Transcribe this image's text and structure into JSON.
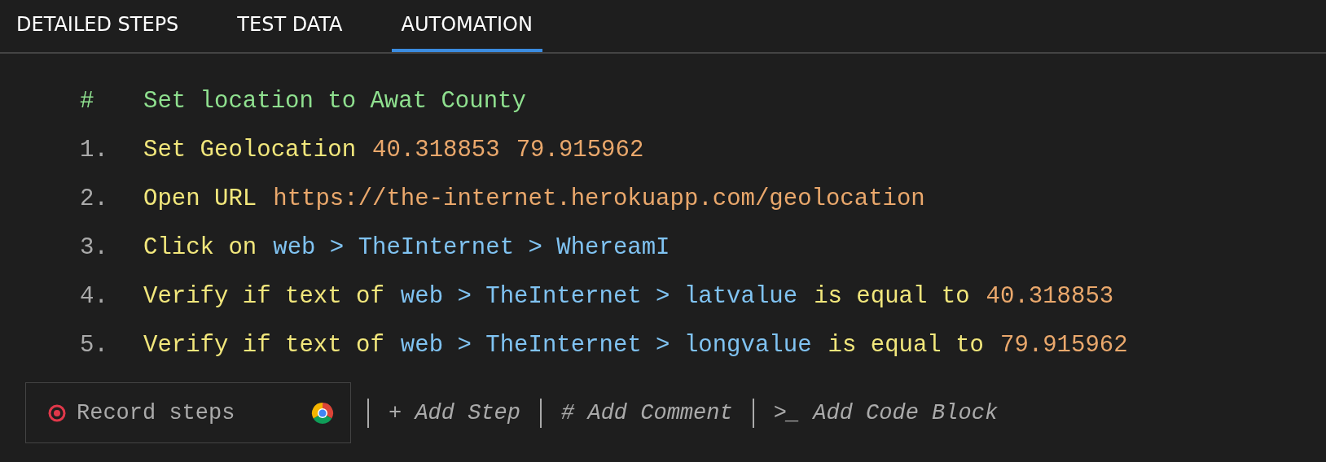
{
  "tabs": [
    {
      "label": "DETAILED STEPS",
      "selected": false
    },
    {
      "label": "TEST DATA",
      "selected": false
    },
    {
      "label": "AUTOMATION",
      "selected": true
    }
  ],
  "steps": [
    {
      "kind": "comment",
      "marker": "#",
      "parts": [
        {
          "kind": "comment",
          "text": "Set location to Awat County"
        }
      ]
    },
    {
      "kind": "step",
      "marker": "1.",
      "parts": [
        {
          "kind": "action",
          "text": "Set Geolocation"
        },
        {
          "kind": "value",
          "text": "40.318853"
        },
        {
          "kind": "value",
          "text": "79.915962"
        }
      ]
    },
    {
      "kind": "step",
      "marker": "2.",
      "parts": [
        {
          "kind": "action",
          "text": "Open URL"
        },
        {
          "kind": "value",
          "text": "https://the-internet.herokuapp.com/geolocation"
        }
      ]
    },
    {
      "kind": "step",
      "marker": "3.",
      "parts": [
        {
          "kind": "action",
          "text": "Click on"
        },
        {
          "kind": "object",
          "text": "web > TheInternet > WhereamI"
        }
      ]
    },
    {
      "kind": "step",
      "marker": "4.",
      "parts": [
        {
          "kind": "action",
          "text": "Verify if text of"
        },
        {
          "kind": "object",
          "text": "web > TheInternet > latvalue"
        },
        {
          "kind": "action",
          "text": "is equal to"
        },
        {
          "kind": "value",
          "text": "40.318853"
        }
      ]
    },
    {
      "kind": "step",
      "marker": "5.",
      "parts": [
        {
          "kind": "action",
          "text": "Verify if text of"
        },
        {
          "kind": "object",
          "text": "web > TheInternet > longvalue"
        },
        {
          "kind": "action",
          "text": "is equal to"
        },
        {
          "kind": "value",
          "text": "79.915962"
        }
      ]
    }
  ],
  "toolbar": {
    "record": {
      "label": "Record steps"
    },
    "actions": [
      "+ Add Step",
      "# Add Comment",
      ">_ Add Code Block"
    ]
  }
}
